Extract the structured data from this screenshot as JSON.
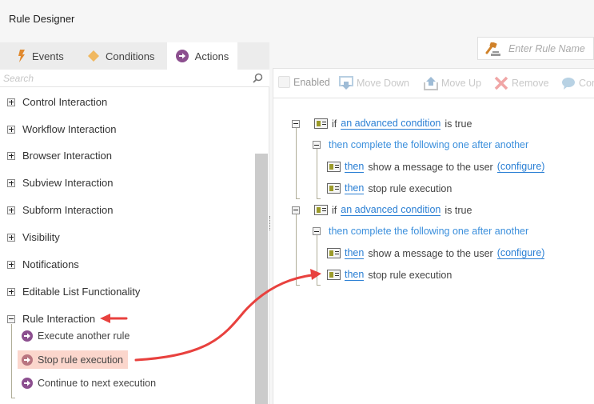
{
  "app": {
    "title": "Rule Designer"
  },
  "tabs": [
    {
      "label": "Events",
      "icon": "lightning-icon",
      "color": "#e0892e"
    },
    {
      "label": "Conditions",
      "icon": "diamond-icon",
      "color": "#f0b860"
    },
    {
      "label": "Actions",
      "icon": "arrow-circle-icon",
      "color": "#8c4f8f",
      "active": true
    }
  ],
  "search": {
    "placeholder": "Search",
    "value": ""
  },
  "categories": [
    {
      "label": "Control Interaction",
      "expanded": false
    },
    {
      "label": "Workflow Interaction",
      "expanded": false
    },
    {
      "label": "Browser Interaction",
      "expanded": false
    },
    {
      "label": "Subview Interaction",
      "expanded": false
    },
    {
      "label": "Subform Interaction",
      "expanded": false
    },
    {
      "label": "Visibility",
      "expanded": false
    },
    {
      "label": "Notifications",
      "expanded": false
    },
    {
      "label": "Editable List Functionality",
      "expanded": false
    },
    {
      "label": "Rule Interaction",
      "expanded": true,
      "items": [
        {
          "label": "Execute another rule",
          "selected": false
        },
        {
          "label": "Stop rule execution",
          "selected": true
        },
        {
          "label": "Continue to next execution",
          "selected": false
        }
      ]
    }
  ],
  "rule_name": {
    "placeholder": "Enter Rule Name",
    "value": ""
  },
  "toolbar": {
    "enabled_label": "Enabled",
    "move_down_label": "Move Down",
    "move_up_label": "Move Up",
    "remove_label": "Remove",
    "comment_label": "Comment"
  },
  "rules": [
    {
      "prefix": "if",
      "condition_link": "an advanced condition",
      "suffix": "is true",
      "group_label": "then complete the following one after another",
      "actions": [
        {
          "then": "then",
          "text": "show a message to the user",
          "configure": "(configure)"
        },
        {
          "then": "then",
          "text": "stop rule execution"
        }
      ]
    },
    {
      "prefix": "if",
      "condition_link": "an advanced condition",
      "suffix": "is true",
      "group_label": "then complete the following one after another",
      "actions": [
        {
          "then": "then",
          "text": "show a message to the user",
          "configure": "(configure)"
        },
        {
          "then": "then",
          "text": "stop rule execution"
        }
      ]
    }
  ],
  "annotation": {
    "arrow_color": "#e8413e"
  }
}
